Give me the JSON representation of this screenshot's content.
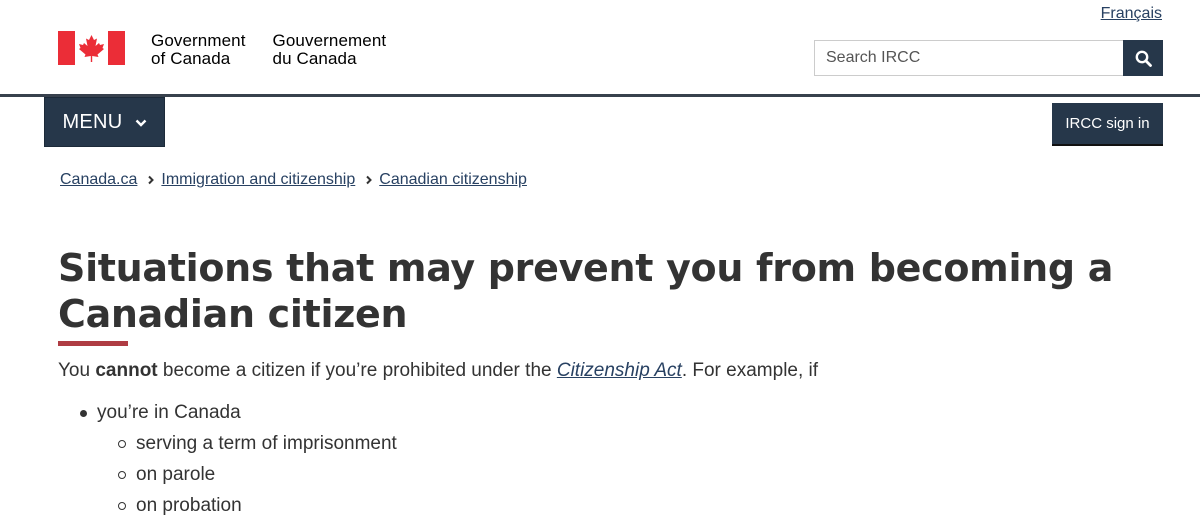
{
  "header": {
    "language_link": "Français",
    "signature_en": [
      "Government",
      "of Canada"
    ],
    "signature_fr": [
      "Gouvernement",
      "du Canada"
    ],
    "search": {
      "placeholder": "Search IRCC",
      "value": ""
    },
    "menu_label": "MENU",
    "sign_in_label": "IRCC sign in"
  },
  "colors": {
    "flag_red": "#eb2d37",
    "nav_dark": "#26374a",
    "title_underline": "#af3c43",
    "link": "#284162"
  },
  "icons": {
    "search": "search-icon",
    "menu_chevron": "chevron-down-icon",
    "breadcrumb_separator": "chevron-right-icon"
  },
  "breadcrumb": [
    {
      "label": "Canada.ca"
    },
    {
      "label": "Immigration and citizenship"
    },
    {
      "label": "Canadian citizenship"
    }
  ],
  "main": {
    "title": "Situations that may prevent you from becoming a Canadian citizen",
    "intro": {
      "before": "You ",
      "emphasis": "cannot",
      "middle": " become a citizen if you’re prohibited under the ",
      "link": "Citizenship Act",
      "after": ". For example, if"
    },
    "list": [
      {
        "label": "you’re in Canada",
        "children": [
          "serving a term of imprisonment",
          "on parole",
          "on probation"
        ]
      }
    ]
  }
}
